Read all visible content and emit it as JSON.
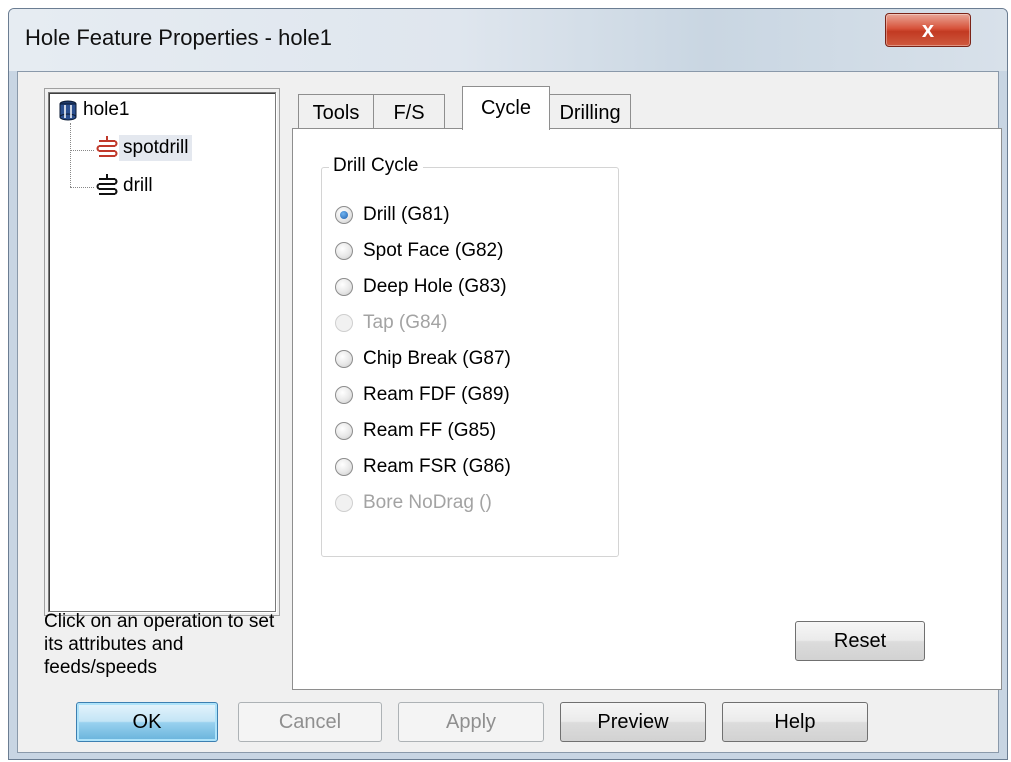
{
  "window": {
    "title": "Hole Feature Properties - hole1",
    "close_label": "x"
  },
  "tree": {
    "items": [
      {
        "label": "hole1",
        "icon": "cylinder-icon"
      },
      {
        "label": "spotdrill",
        "icon": "spotdrill-op-icon",
        "selected": true
      },
      {
        "label": "drill",
        "icon": "drill-op-icon"
      }
    ]
  },
  "hint": "Click on an operation to set its attributes and feeds/speeds",
  "tabs": [
    {
      "label": "Tools"
    },
    {
      "label": "F/S"
    },
    {
      "label": "Cycle",
      "active": true
    },
    {
      "label": "Drilling"
    }
  ],
  "drill_cycle": {
    "title": "Drill Cycle",
    "options": [
      {
        "label": "Drill (G81)",
        "checked": true,
        "disabled": false
      },
      {
        "label": "Spot Face (G82)",
        "checked": false,
        "disabled": false
      },
      {
        "label": "Deep Hole (G83)",
        "checked": false,
        "disabled": false
      },
      {
        "label": "Tap  (G84)",
        "checked": false,
        "disabled": true
      },
      {
        "label": "Chip Break (G87)",
        "checked": false,
        "disabled": false
      },
      {
        "label": "Ream FDF (G89)",
        "checked": false,
        "disabled": false
      },
      {
        "label": "Ream FF (G85)",
        "checked": false,
        "disabled": false
      },
      {
        "label": "Ream FSR (G86)",
        "checked": false,
        "disabled": false
      },
      {
        "label": "Bore NoDrag ()",
        "checked": false,
        "disabled": true
      }
    ]
  },
  "buttons": {
    "reset": "Reset",
    "ok": "OK",
    "cancel": "Cancel",
    "apply": "Apply",
    "preview": "Preview",
    "help": "Help"
  },
  "colors": {
    "close_red": "#c23a22",
    "default_button_blue": "#3c7fb1",
    "disabled_text": "#a3a3a3"
  }
}
